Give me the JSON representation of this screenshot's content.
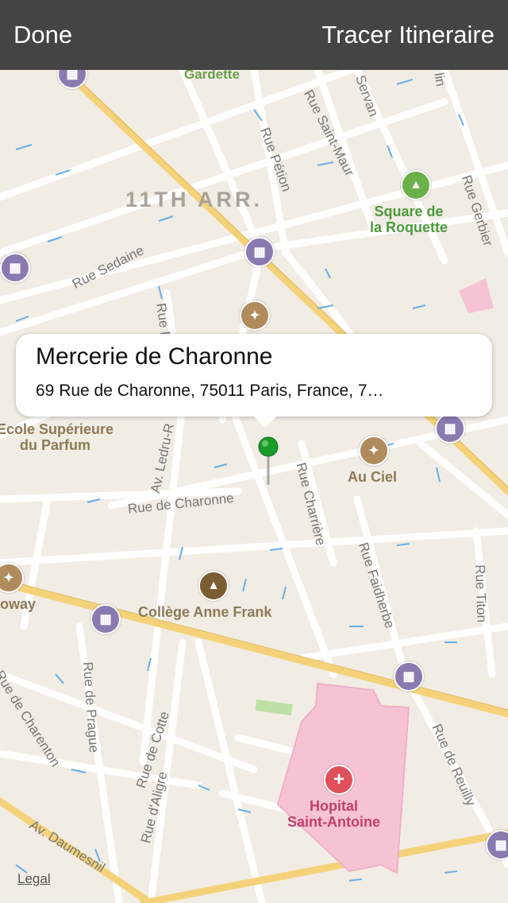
{
  "nav": {
    "done_label": "Done",
    "route_label": "Tracer Itineraire"
  },
  "callout": {
    "title": "Mercerie de Charonne",
    "address": "69 Rue de Charonne, 75011 Paris, France, 7…"
  },
  "map": {
    "district_label": "11TH ARR.",
    "streets": {
      "gardette": "Gardette",
      "rue_saint_maur": "Rue Saint-Maur",
      "rue_petion": "Rue Pétion",
      "servan": "Servan",
      "lin": "lin",
      "rue_gerbier": "Rue Gerbier",
      "rue_sedaine": "Rue Sedaine",
      "rue_r": "Rue R",
      "av_ledru": "Av. Ledru-R",
      "rue_de_charonne": "Rue de Charonne",
      "rue_charriere": "Rue Charrière",
      "rue_faidherbe": "Rue Faidherbe",
      "rue_titon": "Rue Titon",
      "rue_de_charenton": "Rue de Charenton",
      "rue_de_prague": "Rue de Prague",
      "rue_de_cotte": "Rue de Cotte",
      "rue_daligre": "Rue d'Aligre",
      "rue_de_reuilly": "Rue de Reuilly",
      "av_daumesnil": "Av. Daumesnil"
    },
    "places": {
      "square_roquette": "Square de\nla Roquette",
      "ecole_parfum": "Ecole Supérieure\ndu Parfum",
      "au_ciel": "Au Ciel",
      "college": "Collège Anne Frank",
      "oway": "oway",
      "hopital": "Hopital\nSaint-Antoine"
    },
    "legal_label": "Legal"
  },
  "colors": {
    "topbar": "#444444",
    "map_bg": "#f1ede4",
    "major_road": "#f5d27a",
    "pin": "#1a9b2a"
  }
}
